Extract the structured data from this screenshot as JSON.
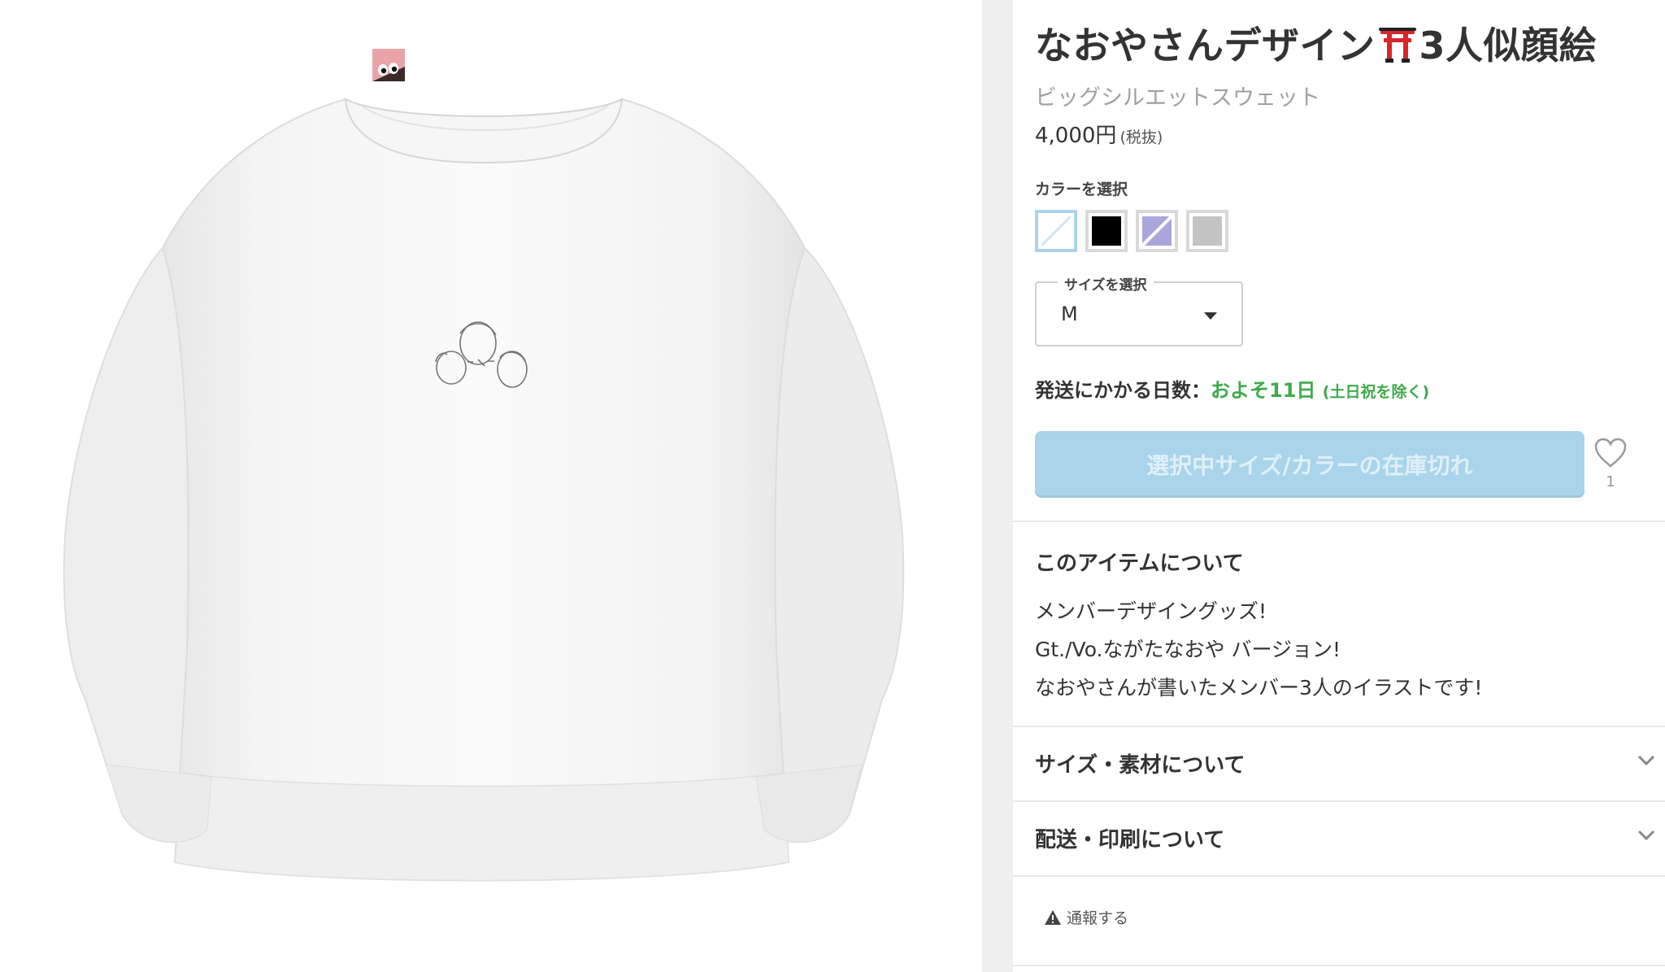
{
  "product": {
    "title_before": "なおやさんデザイン",
    "title_after": "3人似顔絵",
    "item_type": "ビッグシルエットスウェット",
    "price": "4,000円",
    "tax_note": "(税抜)"
  },
  "color": {
    "label": "カラーを選択",
    "options": [
      "white",
      "black",
      "lavender",
      "gray"
    ]
  },
  "size": {
    "label": "サイズを選択",
    "selected": "M"
  },
  "shipping": {
    "label": "発送にかかる日数：",
    "days": "およそ11日",
    "note": "(土日祝を除く)"
  },
  "cart": {
    "button_label": "選択中サイズ/カラーの在庫切れ"
  },
  "favorite": {
    "count": "1"
  },
  "about": {
    "title": "このアイテムについて",
    "lines": [
      "メンバーデザイングッズ!",
      "Gt./Vo.ながたなおや バージョン!",
      "なおやさんが書いたメンバー3人のイラストです!"
    ]
  },
  "accordions": {
    "size_material": "サイズ・素材について",
    "shipping_printing": "配送・印刷について"
  },
  "report": {
    "label": "通報する"
  },
  "colors": {
    "accent_light_blue": "#a9d4ea",
    "ship_green": "#3eaa4a",
    "swatch_black": "#000000",
    "swatch_lavender": "#a9a6dc",
    "swatch_gray": "#c4c4c4"
  },
  "icons": [
    "torii-emoji",
    "heart-icon",
    "chevron-down-icon",
    "warning-icon",
    "brand-badge-icon"
  ]
}
